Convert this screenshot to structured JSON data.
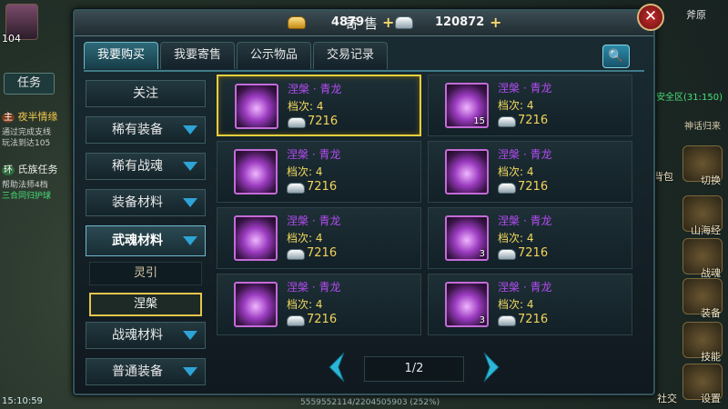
{
  "hud": {
    "level": "104",
    "task_tab": "任务",
    "quests": [
      {
        "tag": "主",
        "title": "夜半情缘",
        "line1": "通过完成支线",
        "line2": "玩法到达105"
      },
      {
        "tag": "环",
        "title": "氏族任务",
        "line1": "帮助法师4档",
        "line2": "三合同归护球"
      }
    ],
    "time": "15:10:59",
    "bottom_info": "5559552114/2204505903 (252%)",
    "top_right": "斧原",
    "green_status": "安全区(31:150)",
    "side_note": "神话归来",
    "right_buttons": [
      {
        "label": "切换",
        "top": 0
      },
      {
        "label": "山海经"
      },
      {
        "label": "战魂"
      },
      {
        "label": "装备"
      },
      {
        "label": "技能"
      },
      {
        "label": "设置"
      }
    ],
    "bag_label": "背包",
    "social_label": "社交"
  },
  "panel": {
    "title": "寄售",
    "gold": "4879",
    "silver": "120872",
    "close_label": "✕"
  },
  "tabs": [
    {
      "label": "我要购买",
      "active": true
    },
    {
      "label": "我要寄售",
      "active": false
    },
    {
      "label": "公示物品",
      "active": false
    },
    {
      "label": "交易记录",
      "active": false
    }
  ],
  "categories": {
    "follow": "关注",
    "rare_equip": "稀有装备",
    "rare_soul": "稀有战魂",
    "equip_mat": "装备材料",
    "soul_mat": "武魂材料",
    "sub_lingyin": "灵引",
    "sub_niepan": "涅槃",
    "battle_mat": "战魂材料",
    "common_equip": "普通装备"
  },
  "items": [
    {
      "name": "涅槃 · 青龙",
      "grade": "档次: 4",
      "price": "7216",
      "count": ""
    },
    {
      "name": "涅槃 · 青龙",
      "grade": "档次: 4",
      "price": "7216",
      "count": "15"
    },
    {
      "name": "涅槃 · 青龙",
      "grade": "档次: 4",
      "price": "7216",
      "count": ""
    },
    {
      "name": "涅槃 · 青龙",
      "grade": "档次: 4",
      "price": "7216",
      "count": ""
    },
    {
      "name": "涅槃 · 青龙",
      "grade": "档次: 4",
      "price": "7216",
      "count": ""
    },
    {
      "name": "涅槃 · 青龙",
      "grade": "档次: 4",
      "price": "7216",
      "count": "3"
    },
    {
      "name": "涅槃 · 青龙",
      "grade": "档次: 4",
      "price": "7216",
      "count": ""
    },
    {
      "name": "涅槃 · 青龙",
      "grade": "档次: 4",
      "price": "7216",
      "count": "3"
    }
  ],
  "pager": {
    "label": "1/2"
  },
  "colors": {
    "item_name": "#b24cf1",
    "grade": "#f1d85e",
    "price": "#f3d35a",
    "selected_border": "#e8cf3e",
    "tab_active": "#2e6a78"
  }
}
